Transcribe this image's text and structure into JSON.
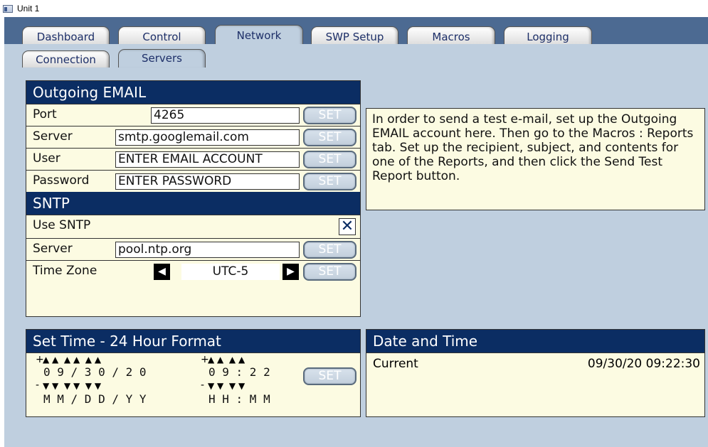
{
  "window": {
    "title": "Unit 1"
  },
  "tabs": [
    "Dashboard",
    "Control",
    "Network",
    "SWP Setup",
    "Macros",
    "Logging"
  ],
  "subtabs": [
    "Connection",
    "Servers"
  ],
  "email": {
    "header": "Outgoing EMAIL",
    "port_label": "Port",
    "port_value": "4265",
    "server_label": "Server",
    "server_value": "smtp.googlemail.com",
    "user_label": "User",
    "user_value": "ENTER EMAIL ACCOUNT",
    "password_label": "Password",
    "password_value": "ENTER PASSWORD",
    "set_label": "SET"
  },
  "sntp": {
    "header": "SNTP",
    "use_label": "Use SNTP",
    "use_checked": "✕",
    "server_label": "Server",
    "server_value": "pool.ntp.org",
    "tz_label": "Time Zone",
    "tz_value": "UTC-5",
    "set_label": "SET"
  },
  "info_text": "In order to send a test e-mail, set up the Outgoing EMAIL account here. Then go to the Macros : Reports tab. Set up the recipient, subject, and contents for one of the Reports, and then click the Send Test Report button.",
  "set_time": {
    "header": "Set Time - 24 Hour Format",
    "date_digits": "0 9 / 3 0 / 2 0",
    "date_labels": "M M / D D / Y Y",
    "time_digits": "0 9 : 2 2",
    "time_labels": "H H : M M",
    "plus": "+",
    "minus": "-",
    "set_label": "SET"
  },
  "datetime": {
    "header": "Date and Time",
    "current_label": "Current",
    "current_value": "09/30/20 09:22:30"
  },
  "colors": {
    "header_bg": "#0b2d63",
    "panel_bg": "#fcfbe2",
    "frame_bg": "#4c6a92",
    "content_bg": "#bfcfdf"
  }
}
